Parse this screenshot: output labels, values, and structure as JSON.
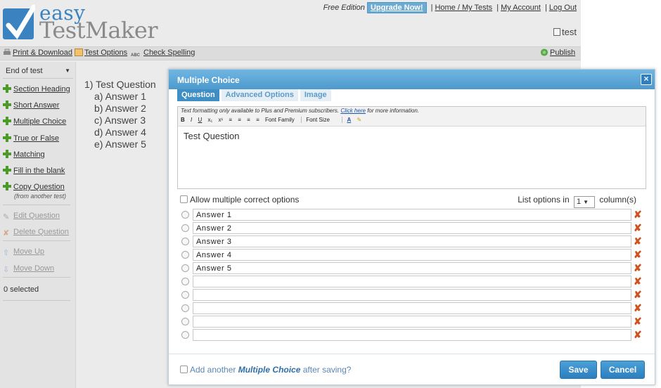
{
  "brand": {
    "line1": "easy",
    "line2": "TestMaker"
  },
  "topnav": {
    "edition": "Free Edition",
    "upgrade": "Upgrade Now!",
    "home": "Home / My Tests",
    "account": "My Account",
    "logout": "Log Out",
    "sep": "|"
  },
  "user": {
    "name": "test"
  },
  "toolbar": {
    "print": "Print & Download",
    "options": "Test Options",
    "spelling": "Check Spelling",
    "spelling_icon_text": "ABC",
    "publish": "Publish"
  },
  "sidebar": {
    "position_select": "End of test",
    "items": [
      {
        "label": "Section Heading"
      },
      {
        "label": "Short Answer"
      },
      {
        "label": "Multiple Choice"
      },
      {
        "label": "True or False"
      },
      {
        "label": "Matching"
      },
      {
        "label": "Fill in the blank"
      },
      {
        "label": "Copy Question"
      }
    ],
    "copy_sub": "(from another test)",
    "edit": "Edit Question",
    "delete": "Delete Question",
    "move_up": "Move Up",
    "move_down": "Move Down",
    "selected": "0 selected"
  },
  "preview": {
    "question": "1) Test Question",
    "answers": [
      "a) Answer 1",
      "b) Answer 2",
      "c) Answer 3",
      "d) Answer 4",
      "e) Answer 5"
    ]
  },
  "modal": {
    "title": "Multiple Choice",
    "close": "×",
    "tabs": [
      "Question",
      "Advanced Options",
      "Image"
    ],
    "editor": {
      "note_pre": "Text formatting only available to Plus and Premium subscribers.",
      "note_link": "Click here",
      "note_post": "for more information.",
      "font_family": "Font Family",
      "font_size": "Font Size",
      "text_color_glyph": "A",
      "buttons": {
        "bold": "B",
        "italic": "I",
        "underline": "U",
        "subscript": "x₁",
        "superscript": "x¹"
      },
      "content": "Test Question"
    },
    "allow_multiple": "Allow multiple correct options",
    "list_options_pre": "List options in",
    "columns_value": "1",
    "list_options_post": "column(s)",
    "answers": [
      "Answer 1",
      "Answer 2",
      "Answer 3",
      "Answer 4",
      "Answer 5",
      "",
      "",
      "",
      "",
      ""
    ],
    "delete_glyph": "✘",
    "add_another_pre": "Add another",
    "add_another_type": "Multiple Choice",
    "add_another_post": "after saving?",
    "save": "Save",
    "cancel": "Cancel"
  },
  "colors": {
    "accent": "#3f8ec6",
    "brand_blue": "#3b83c0",
    "delete_red": "#d0501e",
    "plus_green": "#4c9a2a"
  }
}
